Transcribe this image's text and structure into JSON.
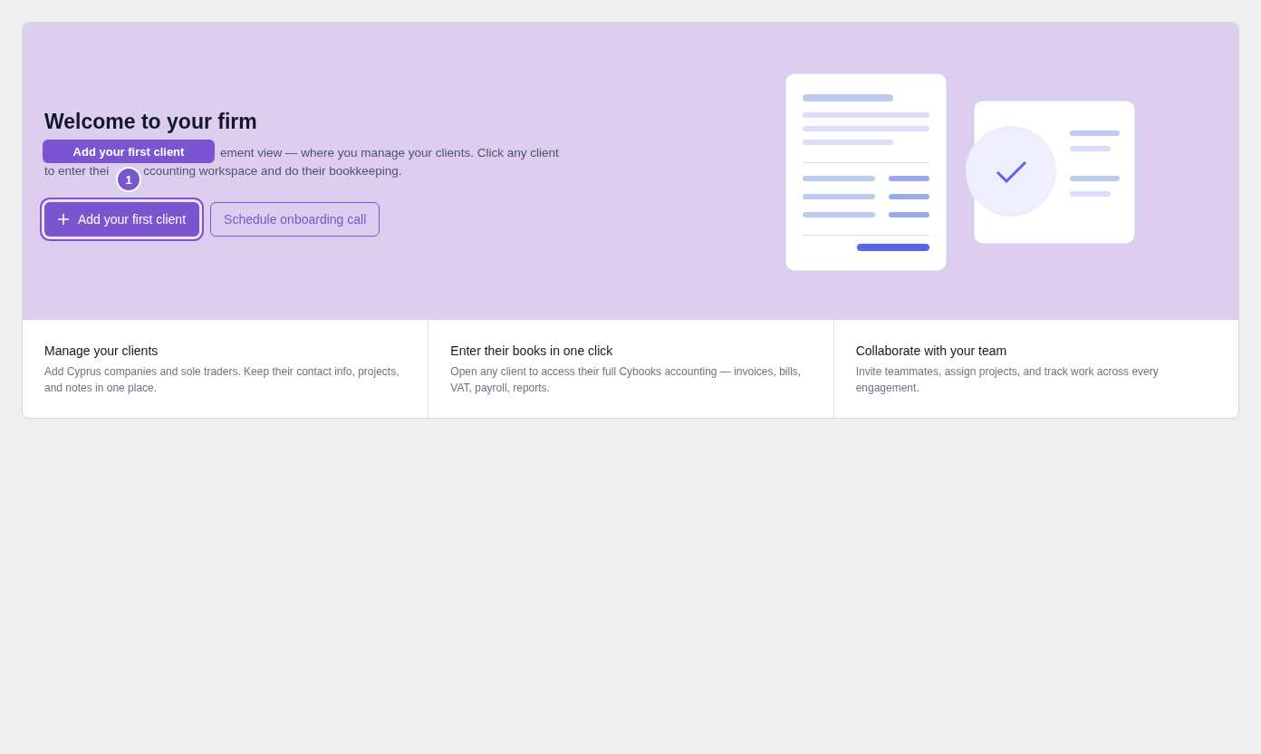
{
  "hero": {
    "title": "Welcome to your firm",
    "description_lines": [
      {
        "segments": [
          "ement view — where you manage your clients. Click any client"
        ]
      },
      {
        "segments": [
          "to enter thei",
          "ccounting workspace and do their bookkeeping."
        ]
      }
    ],
    "tooltip": {
      "text": "Add your first client"
    },
    "step_badge": {
      "text": "1"
    },
    "buttons": [
      {
        "label": "Add your first client",
        "kind": "primary",
        "focused": true
      },
      {
        "label": "Schedule onboarding call",
        "kind": "secondary",
        "focused": false
      }
    ]
  },
  "features": [
    {
      "title": "Manage your clients",
      "description": "Add Cyprus companies and sole traders. Keep their contact info, projects, and notes in one place."
    },
    {
      "title": "Enter their books in one click",
      "description": "Open any client to access their full Cybooks accounting — invoices, bills, VAT, payroll, reports."
    },
    {
      "title": "Collaborate with your team",
      "description": "Invite teammates, assign projects, and track work across every engagement."
    }
  ]
}
